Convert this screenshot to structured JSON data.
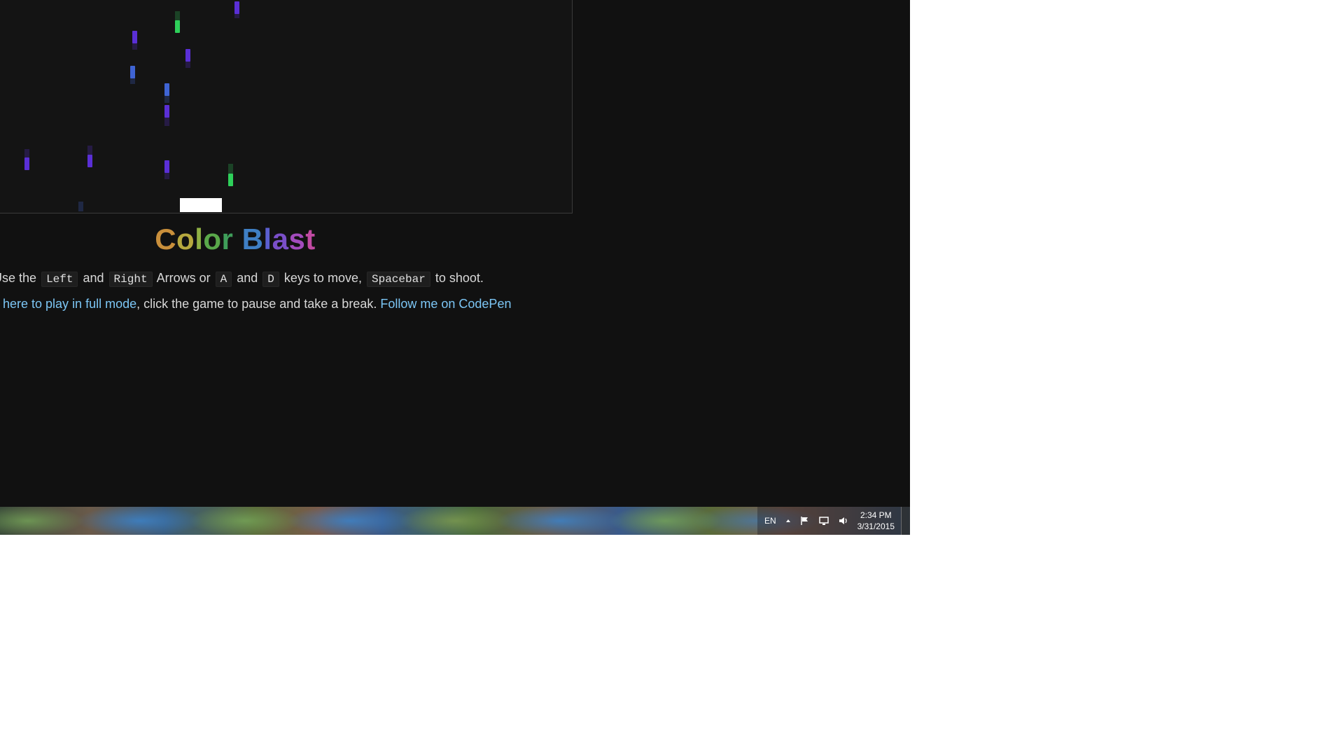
{
  "game": {
    "title_letters": [
      {
        "char": "C",
        "color": "#c98f3b"
      },
      {
        "char": "o",
        "color": "#b7a83e"
      },
      {
        "char": "l",
        "color": "#8fb044"
      },
      {
        "char": "o",
        "color": "#5aa84a"
      },
      {
        "char": "r",
        "color": "#3f9e5a"
      },
      {
        "char": " ",
        "color": "#ffffff"
      },
      {
        "char": "B",
        "color": "#3f7fc4"
      },
      {
        "char": "l",
        "color": "#5b5fd0"
      },
      {
        "char": "a",
        "color": "#7a4fc8"
      },
      {
        "char": "s",
        "color": "#a24bbd"
      },
      {
        "char": "t",
        "color": "#c14aa3"
      }
    ],
    "colors": {
      "purple": "#5a2fd6",
      "blue": "#3f64d4",
      "green": "#2ed05a",
      "player": "#ffffff",
      "link": "#7cc6f5"
    },
    "bullet_color_names": [
      "purple",
      "purple",
      "blue",
      "blue",
      "purple",
      "purple",
      "green",
      "purple",
      "purple",
      "purple",
      "purple",
      "green"
    ]
  },
  "instructions": {
    "line1": {
      "t1": "Use the",
      "k1": "Left",
      "t2": "and",
      "k2": "Right",
      "t3": "Arrows or",
      "k3": "A",
      "t4": "and",
      "k4": "D",
      "t5": "keys to move,",
      "k5": "Spacebar",
      "t6": "to shoot."
    },
    "line2": {
      "link1": "k here to play in full mode",
      "t1": ", click the game to pause and take a break.",
      "link2": "Follow me on CodePen"
    }
  },
  "taskbar": {
    "language": "EN",
    "time": "2:34 PM",
    "date": "3/31/2015",
    "icons": [
      "show-hidden-icons-arrow-icon",
      "action-center-flag-icon",
      "network-icon",
      "volume-icon"
    ]
  }
}
